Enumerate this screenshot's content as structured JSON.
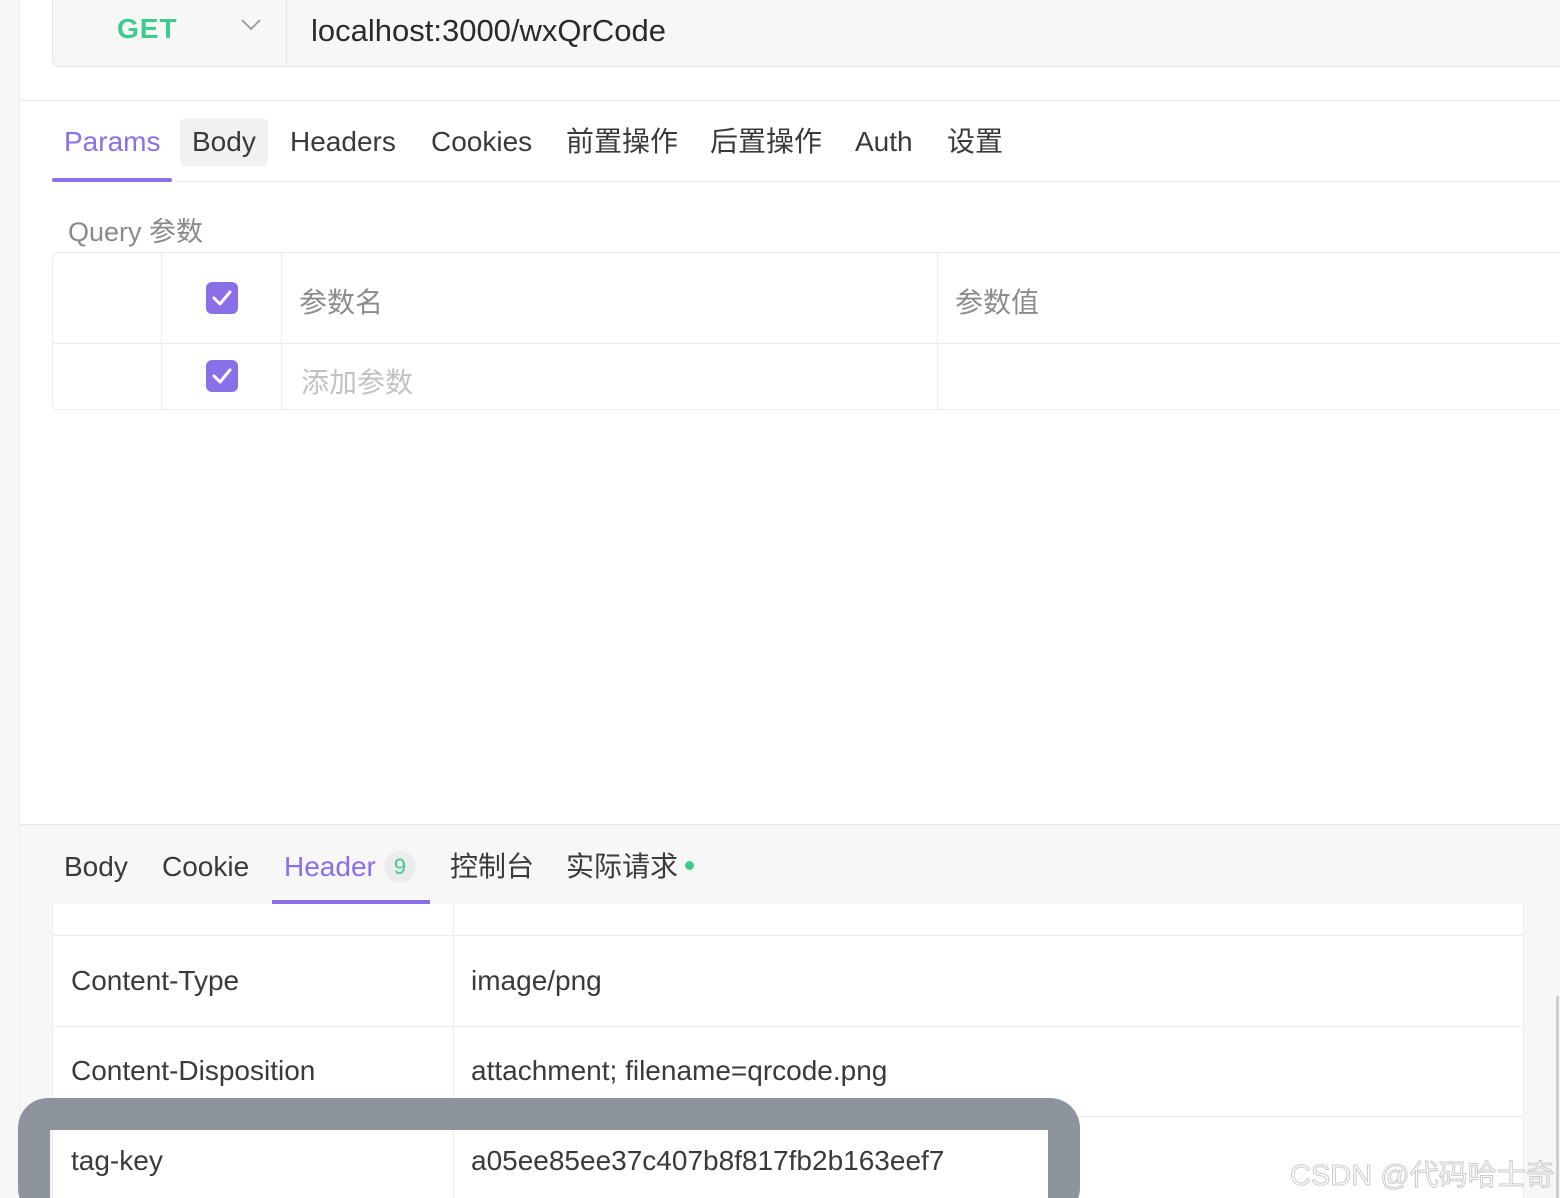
{
  "request": {
    "method": "GET",
    "url": "localhost:3000/wxQrCode"
  },
  "request_tabs": {
    "params": "Params",
    "body": "Body",
    "headers": "Headers",
    "cookies": "Cookies",
    "pre": "前置操作",
    "post": "后置操作",
    "auth": "Auth",
    "settings": "设置"
  },
  "query": {
    "title": "Query 参数",
    "col_name": "参数名",
    "col_value": "参数值",
    "add_placeholder": "添加参数"
  },
  "response_tabs": {
    "body": "Body",
    "cookie": "Cookie",
    "header": "Header",
    "header_count": "9",
    "console": "控制台",
    "actual_request": "实际请求"
  },
  "response_headers": [
    {
      "key": "Content-Type",
      "value": "image/png"
    },
    {
      "key": "Content-Disposition",
      "value": "attachment; filename=qrcode.png"
    },
    {
      "key": "tag-key",
      "value": "a05ee85ee37c407b8f817fb2b163eef7"
    }
  ],
  "watermark": "CSDN @代码哈士奇",
  "colors": {
    "accent": "#8b6fe6",
    "method_get": "#3fca8f",
    "highlight_frame": "#8d949c"
  }
}
